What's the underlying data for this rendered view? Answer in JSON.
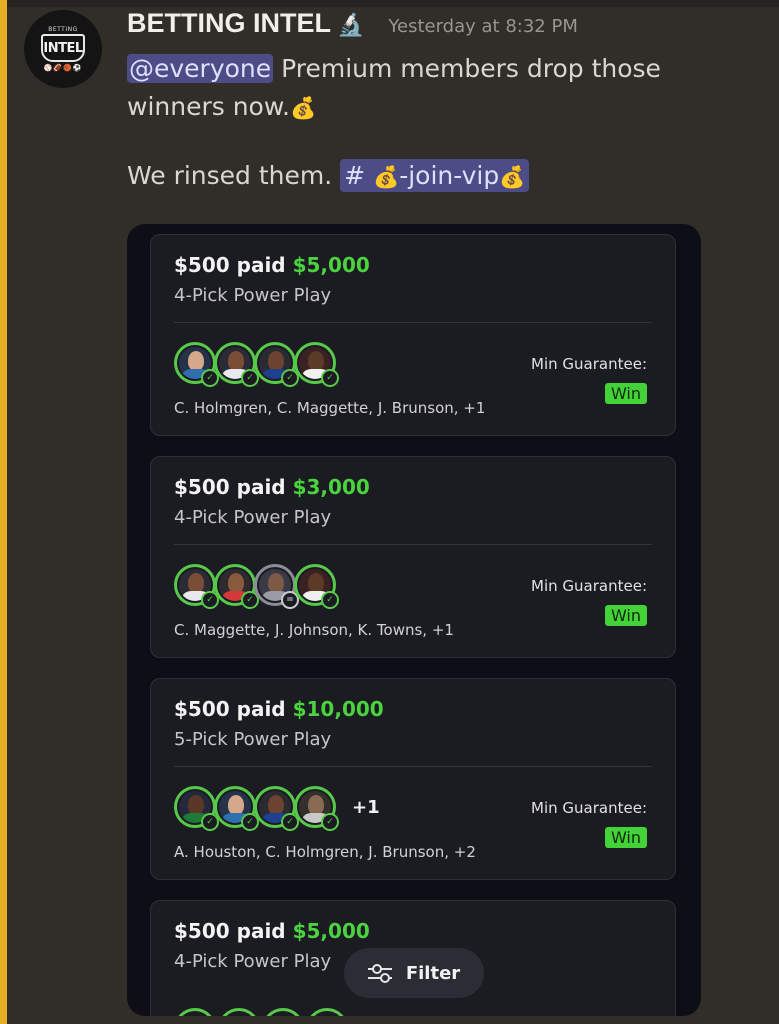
{
  "message": {
    "author": "BETTING INTEL",
    "author_emoji": "🔬",
    "timestamp": "Yesterday at 8:32 PM",
    "avatar": {
      "top_text": "BETTING",
      "main_text": "INTEL",
      "balls": "⚾🏈🏀⚽"
    },
    "mention": "@everyone",
    "line1": " Premium members drop those winners now.",
    "emoji_money": "💰",
    "line2": "We rinsed them. ",
    "channel": {
      "hash": "# ",
      "name": "-join-vip"
    }
  },
  "cards": [
    {
      "paid": "$500 paid",
      "amount": "$5,000",
      "type": "4-Pick Power Play",
      "players": "C. Holmgren, C. Maggette, J. Brunson, +1",
      "min_label": "Min Guarantee:",
      "result": "Win"
    },
    {
      "paid": "$500 paid",
      "amount": "$3,000",
      "type": "4-Pick Power Play",
      "players": "C. Maggette, J. Johnson, K. Towns, +1",
      "min_label": "Min Guarantee:",
      "result": "Win"
    },
    {
      "paid": "$500 paid",
      "amount": "$10,000",
      "type": "5-Pick Power Play",
      "players": "A. Houston, C. Holmgren, J. Brunson, +2",
      "min_label": "Min Guarantee:",
      "result": "Win",
      "more": "+1"
    },
    {
      "paid": "$500 paid",
      "amount": "$5,000",
      "type": "4-Pick Power Play"
    }
  ],
  "filter_label": "Filter",
  "colors": {
    "accent": "#e7ad24",
    "win_green": "#43d237",
    "mention_bg": "#4c4c87"
  }
}
